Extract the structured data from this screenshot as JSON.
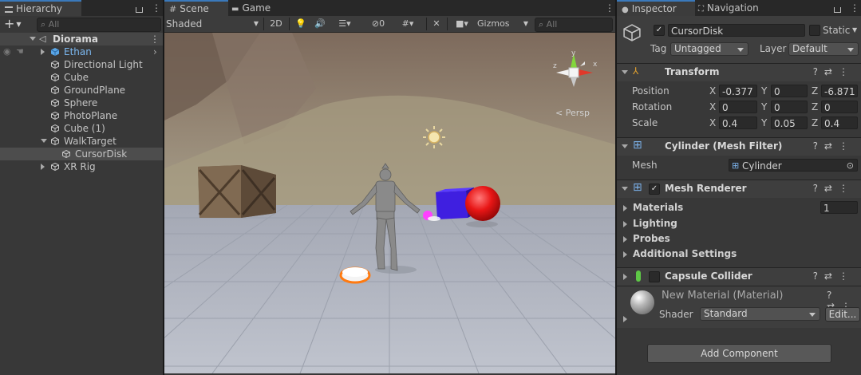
{
  "hierarchy": {
    "tab_label": "Hierarchy",
    "search_placeholder": "All",
    "scene_name": "Diorama",
    "items": [
      {
        "label": "Ethan"
      },
      {
        "label": "Directional Light"
      },
      {
        "label": "Cube"
      },
      {
        "label": "GroundPlane"
      },
      {
        "label": "Sphere"
      },
      {
        "label": "PhotoPlane"
      },
      {
        "label": "Cube (1)"
      },
      {
        "label": "WalkTarget"
      },
      {
        "label": "CursorDisk"
      },
      {
        "label": "XR Rig"
      }
    ]
  },
  "scene": {
    "tabs": [
      {
        "label": "Scene"
      },
      {
        "label": "Game"
      }
    ],
    "shading_mode": "Shaded",
    "mode_2d": "2D",
    "hidden_count": "0",
    "gizmos_label": "Gizmos",
    "search_placeholder": "All",
    "gizmo_axes": {
      "x": "x",
      "y": "y",
      "z": "z"
    },
    "projection_label": "Persp"
  },
  "inspector": {
    "tabs": [
      {
        "label": "Inspector"
      },
      {
        "label": "Navigation"
      }
    ],
    "object_name": "CursorDisk",
    "static_label": "Static",
    "tag_label": "Tag",
    "tag_value": "Untagged",
    "layer_label": "Layer",
    "layer_value": "Default",
    "transform": {
      "title": "Transform",
      "position_label": "Position",
      "rotation_label": "Rotation",
      "scale_label": "Scale",
      "axis_x": "X",
      "axis_y": "Y",
      "axis_z": "Z",
      "position": {
        "x": "-0.377",
        "y": "0",
        "z": "-6.871"
      },
      "rotation": {
        "x": "0",
        "y": "0",
        "z": "0"
      },
      "scale": {
        "x": "0.4",
        "y": "0.05",
        "z": "0.4"
      }
    },
    "mesh_filter": {
      "title": "Cylinder (Mesh Filter)",
      "mesh_label": "Mesh",
      "mesh_value": "Cylinder"
    },
    "mesh_renderer": {
      "title": "Mesh Renderer",
      "materials_label": "Materials",
      "materials_count": "1",
      "lighting_label": "Lighting",
      "probes_label": "Probes",
      "additional_label": "Additional Settings"
    },
    "capsule_collider": {
      "title": "Capsule Collider"
    },
    "material": {
      "name": "New Material (Material)",
      "shader_label": "Shader",
      "shader_value": "Standard",
      "edit_label": "Edit..."
    },
    "add_component_label": "Add Component"
  }
}
